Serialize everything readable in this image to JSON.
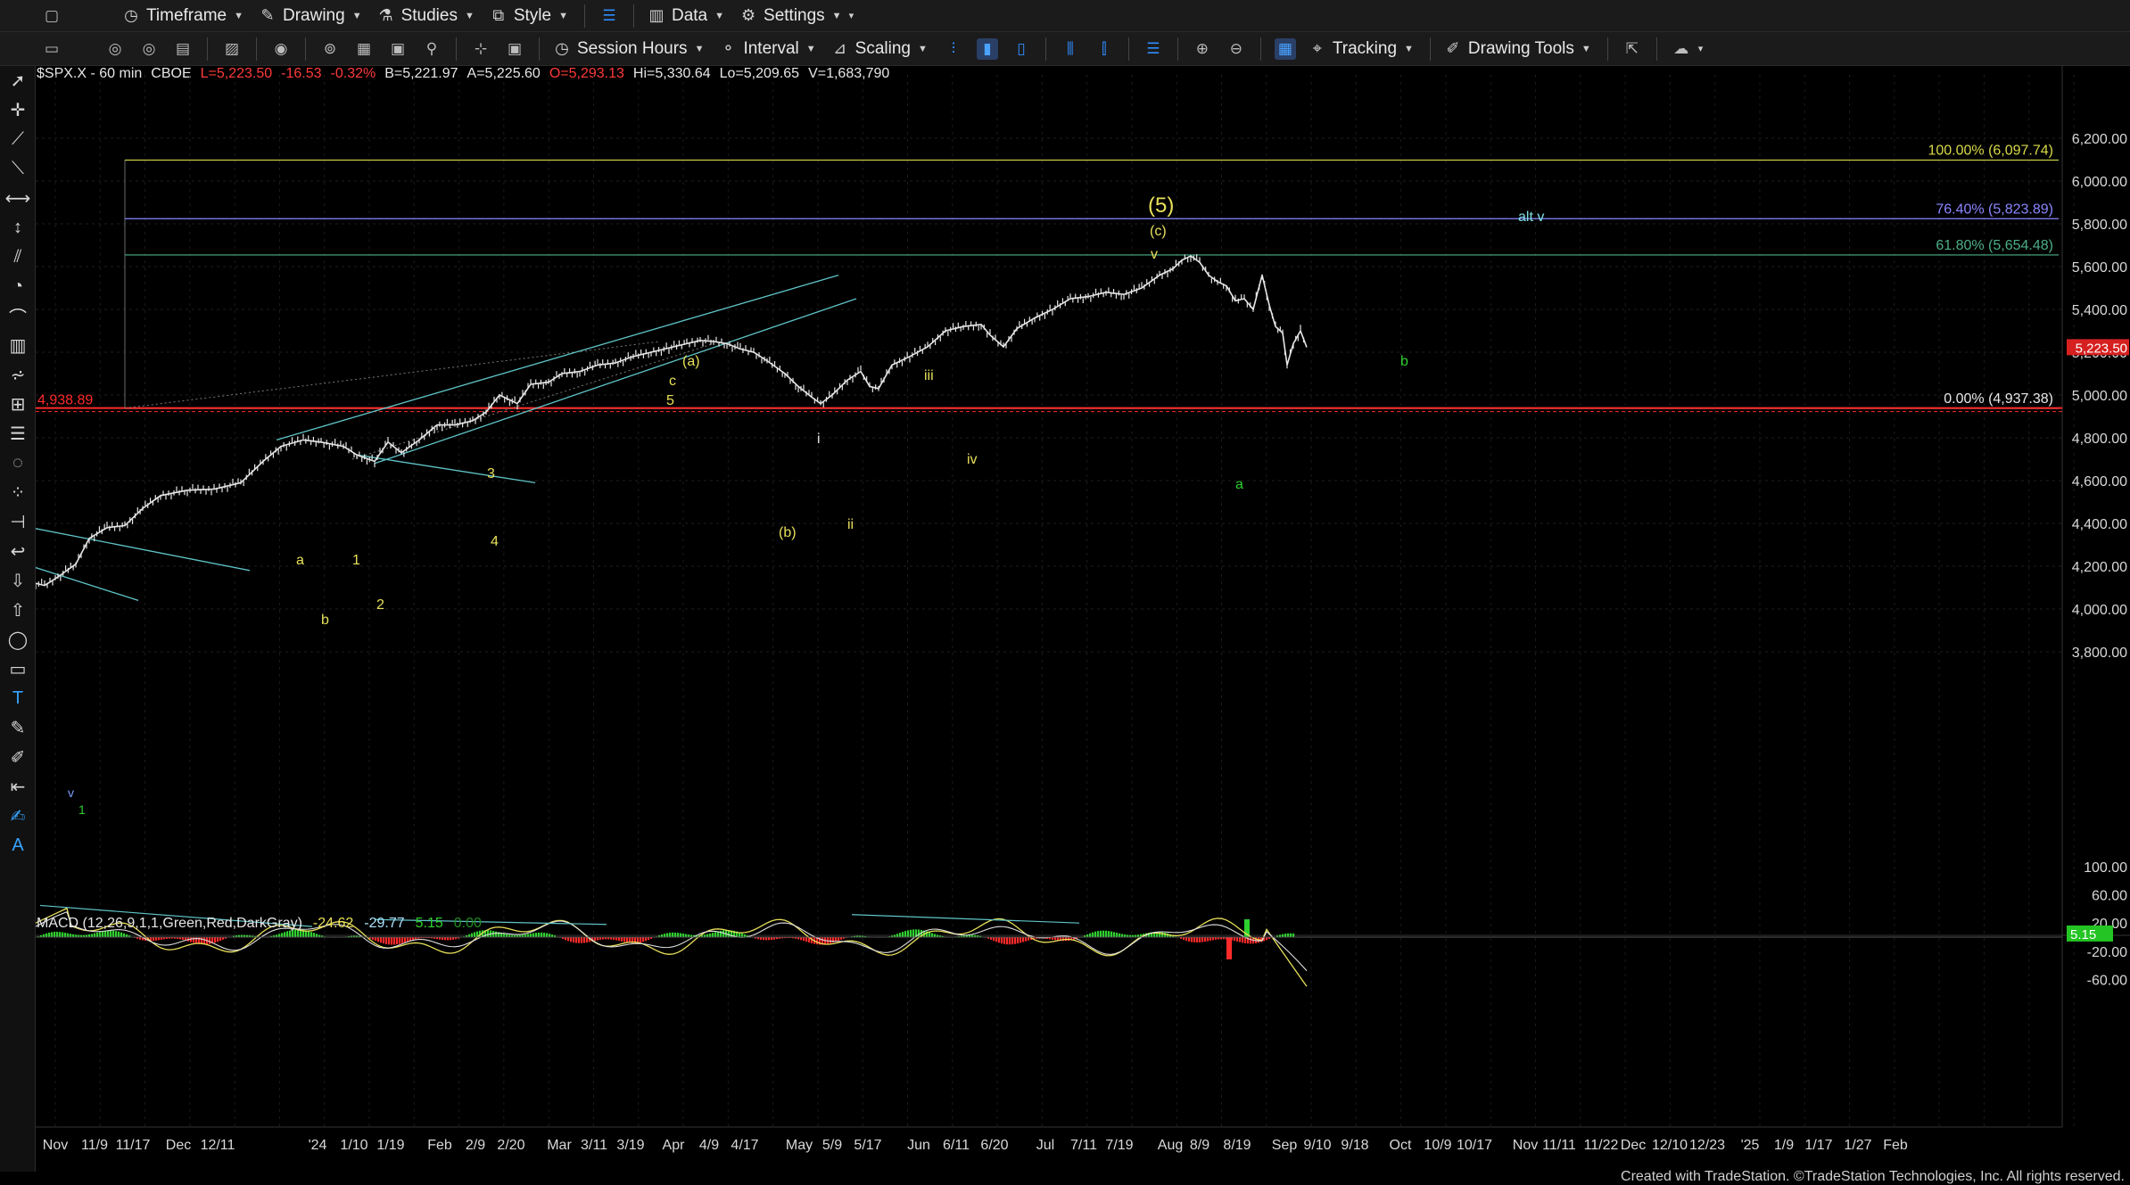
{
  "toolbar1": {
    "items": [
      {
        "label": "Timeframe",
        "icon": "clock-icon"
      },
      {
        "label": "Drawing",
        "icon": "pen-icon"
      },
      {
        "label": "Studies",
        "icon": "studies-icon"
      },
      {
        "label": "Style",
        "icon": "style-icon"
      },
      {
        "label": "Data",
        "icon": "bar-chart-icon"
      },
      {
        "label": "Settings",
        "icon": "gear-icon"
      }
    ]
  },
  "toolbar2": {
    "session_hours": "Session Hours",
    "interval": "Interval",
    "scaling": "Scaling",
    "tracking": "Tracking",
    "drawing_tools": "Drawing Tools"
  },
  "symbol": {
    "name": "$SPX.X - 60 min",
    "exchange": "CBOE",
    "last": "L=5,223.50",
    "change": "-16.53",
    "change_pct": "-0.32%",
    "bid": "B=5,221.97",
    "ask": "A=5,225.60",
    "open": "O=5,293.13",
    "high": "Hi=5,330.64",
    "low": "Lo=5,209.65",
    "volume": "V=1,683,790"
  },
  "macd": {
    "label": "MACD (12,26,9,1,1,Green,Red,DarkGray)",
    "v1": "-24.62",
    "v2": "-29.77",
    "v3": "5.15",
    "v4": "0.00",
    "current_tag": "5.15"
  },
  "price_axis": {
    "labels": [
      "6,200.00",
      "6,000.00",
      "5,800.00",
      "5,600.00",
      "5,400.00",
      "5,200.00",
      "5,000.00",
      "4,800.00",
      "4,600.00",
      "4,400.00",
      "4,200.00",
      "4,000.00",
      "3,800.00"
    ],
    "current_tag": "5,223.50"
  },
  "macd_axis": {
    "labels": [
      "100.00",
      "60.00",
      "20.00",
      "-20.00",
      "-60.00"
    ]
  },
  "time_axis": {
    "labels": [
      "Nov",
      "11/9",
      "11/17",
      "Dec",
      "12/11",
      "'24",
      "1/10",
      "1/19",
      "Feb",
      "2/9",
      "2/20",
      "Mar",
      "3/11",
      "3/19",
      "Apr",
      "4/9",
      "4/17",
      "May",
      "5/9",
      "5/17",
      "Jun",
      "6/11",
      "6/20",
      "Jul",
      "7/11",
      "7/19",
      "Aug",
      "8/9",
      "8/19",
      "Sep",
      "9/10",
      "9/18",
      "Oct",
      "10/9",
      "10/17",
      "Nov",
      "11/11",
      "11/22",
      "Dec",
      "12/10",
      "12/23",
      "'25",
      "1/9",
      "1/17",
      "1/27",
      "Feb"
    ]
  },
  "fib_levels": [
    {
      "label": "100.00% (6,097.74)",
      "color": "#d8d84a"
    },
    {
      "label": "76.40% (5,823.89)",
      "color": "#8a86ff"
    },
    {
      "label": "61.80% (5,654.48)",
      "color": "#4caf88"
    },
    {
      "label": "0.00% (4,937.38)",
      "color": "#e8e8e8"
    }
  ],
  "support_label": "4,938.89",
  "wave_labels": {
    "w5": "(5)",
    "wc": "(c)",
    "wv": "v",
    "wa_paren": "(a)",
    "wc_small": "c",
    "w5_small": "5",
    "wb_paren": "(b)",
    "wii": "ii",
    "wi": "i",
    "wiii": "iii",
    "wiv": "iv",
    "w3": "3",
    "w4": "4",
    "w1": "1",
    "w2": "2",
    "wa_small": "a",
    "wb_small": "b",
    "wv_low": "v",
    "w1_low": "1",
    "alt_v": "alt v",
    "green_b": "b",
    "green_a": "a"
  },
  "footer": "Created with TradeStation. ©TradeStation Technologies, Inc. All rights reserved.",
  "colors": {
    "candle": "#e6e6e6",
    "wave_yellow": "#e8e05a",
    "channel_cyan": "#5fc4c8",
    "green": "#2fd12f",
    "red": "#ff2a2a",
    "macd_line": "#e8e05a",
    "signal_line": "#e0e0e0"
  }
}
